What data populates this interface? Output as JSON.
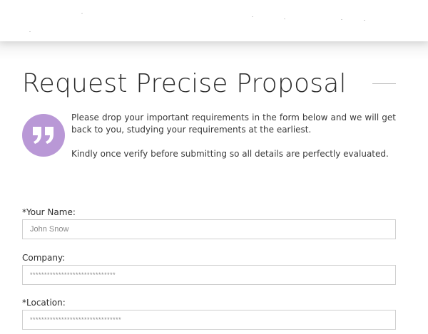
{
  "title": "Request Precise Proposal",
  "intro": {
    "paragraph_1": "Please drop your important requirements in the form below and we will get back to you, studying your requirements at the earliest.",
    "paragraph_2": "Kindly once verify before submitting so all details are perfectly evaluated."
  },
  "quote_icon": "quote-icon",
  "colors": {
    "quote_badge": "#b998d6",
    "input_border": "#cfcfcf"
  },
  "form": {
    "name": {
      "label": "*Your Name:",
      "placeholder": "John Snow"
    },
    "company": {
      "label": "Company:",
      "placeholder": "******************************"
    },
    "location": {
      "label": "*Location:",
      "placeholder": "********************************"
    }
  }
}
